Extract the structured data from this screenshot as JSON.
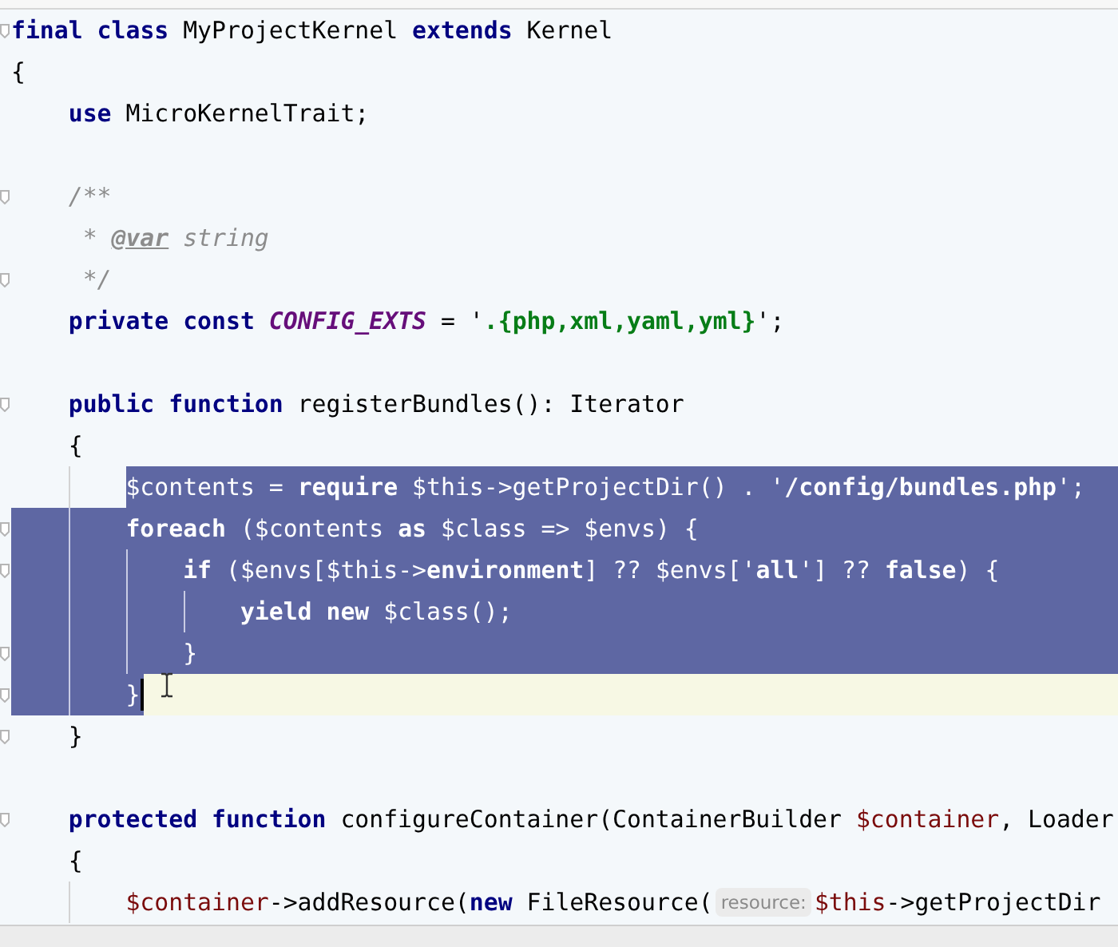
{
  "editor": {
    "lines": [
      {
        "fold": true,
        "selected": false,
        "current": false,
        "caret": false,
        "tokens": [
          {
            "kind": "keyword",
            "text": "final"
          },
          {
            "kind": "keyword",
            "text": " class"
          },
          {
            "kind": "plain",
            "text": " MyProjectKernel "
          },
          {
            "kind": "keyword",
            "text": "extends"
          },
          {
            "kind": "plain",
            "text": " Kernel"
          }
        ]
      },
      {
        "fold": false,
        "selected": false,
        "current": false,
        "caret": false,
        "tokens": [
          {
            "kind": "plain",
            "text": "{"
          }
        ]
      },
      {
        "fold": false,
        "selected": false,
        "current": false,
        "caret": false,
        "tokens": [
          {
            "kind": "keyword",
            "text": "    use"
          },
          {
            "kind": "plain",
            "text": " MicroKernelTrait;"
          }
        ]
      },
      {
        "fold": false,
        "selected": false,
        "current": false,
        "caret": false
      },
      {
        "fold": true,
        "selected": false,
        "current": false,
        "caret": false,
        "tokens": [
          {
            "kind": "comment",
            "text": "    /**"
          }
        ]
      },
      {
        "fold": false,
        "selected": false,
        "current": false,
        "caret": false,
        "tokens": [
          {
            "kind": "comment",
            "text": "     * "
          },
          {
            "kind": "doc_tag",
            "text": "@var"
          },
          {
            "kind": "comment",
            "text": " string"
          }
        ]
      },
      {
        "fold": true,
        "selected": false,
        "current": false,
        "caret": false,
        "tokens": [
          {
            "kind": "comment",
            "text": "     */"
          }
        ]
      },
      {
        "fold": false,
        "selected": false,
        "current": false,
        "caret": false,
        "tokens": [
          {
            "kind": "keyword",
            "text": "    private"
          },
          {
            "kind": "keyword",
            "text": " const"
          },
          {
            "kind": "constant",
            "text": " CONFIG_EXTS"
          },
          {
            "kind": "plain",
            "text": " = '"
          },
          {
            "kind": "string",
            "text": ".{php,xml,yaml,yml}"
          },
          {
            "kind": "plain",
            "text": "';"
          }
        ]
      },
      {
        "fold": false,
        "selected": false,
        "current": false,
        "caret": false
      },
      {
        "fold": true,
        "selected": false,
        "current": false,
        "caret": false,
        "tokens": [
          {
            "kind": "keyword",
            "text": "    public"
          },
          {
            "kind": "keyword",
            "text": " function"
          },
          {
            "kind": "plain",
            "text": " registerBundles(): Iterator"
          }
        ]
      },
      {
        "fold": false,
        "selected": false,
        "current": false,
        "caret": false,
        "tokens": [
          {
            "kind": "plain",
            "text": "    {"
          }
        ]
      },
      {
        "fold": false,
        "selected": true,
        "current": false,
        "caret": false,
        "tokens": [
          {
            "kind": "variable",
            "text": "        $contents"
          },
          {
            "kind": "plain",
            "text": " = "
          },
          {
            "kind": "keyword",
            "text": "require"
          },
          {
            "kind": "variable",
            "text": " $this"
          },
          {
            "kind": "plain",
            "text": "->getProjectDir() . '"
          },
          {
            "kind": "string",
            "text": "/config/bundles.php"
          },
          {
            "kind": "plain",
            "text": "';"
          }
        ]
      },
      {
        "fold": true,
        "selected": true,
        "current": false,
        "caret": false,
        "tokens": [
          {
            "kind": "keyword",
            "text": "        foreach"
          },
          {
            "kind": "plain",
            "text": " ("
          },
          {
            "kind": "variable",
            "text": "$contents"
          },
          {
            "kind": "keyword",
            "text": " as"
          },
          {
            "kind": "variable",
            "text": " $class"
          },
          {
            "kind": "plain",
            "text": " => "
          },
          {
            "kind": "variable",
            "text": "$envs"
          },
          {
            "kind": "plain",
            "text": ") {"
          }
        ]
      },
      {
        "fold": true,
        "selected": true,
        "current": false,
        "caret": false,
        "tokens": [
          {
            "kind": "keyword",
            "text": "            if"
          },
          {
            "kind": "plain",
            "text": " ("
          },
          {
            "kind": "variable",
            "text": "$envs"
          },
          {
            "kind": "plain",
            "text": "["
          },
          {
            "kind": "variable",
            "text": "$this"
          },
          {
            "kind": "plain",
            "text": "->"
          },
          {
            "kind": "field",
            "text": "environment"
          },
          {
            "kind": "plain",
            "text": "] ?? "
          },
          {
            "kind": "variable",
            "text": "$envs"
          },
          {
            "kind": "plain",
            "text": "['"
          },
          {
            "kind": "string",
            "text": "all"
          },
          {
            "kind": "plain",
            "text": "'] ?? "
          },
          {
            "kind": "keyword",
            "text": "false"
          },
          {
            "kind": "plain",
            "text": ") {"
          }
        ]
      },
      {
        "fold": false,
        "selected": true,
        "current": false,
        "caret": false,
        "tokens": [
          {
            "kind": "keyword",
            "text": "                yield"
          },
          {
            "kind": "keyword",
            "text": " new"
          },
          {
            "kind": "variable",
            "text": " $class"
          },
          {
            "kind": "plain",
            "text": "();"
          }
        ]
      },
      {
        "fold": true,
        "selected": true,
        "current": false,
        "caret": false,
        "tokens": [
          {
            "kind": "plain",
            "text": "            }"
          }
        ]
      },
      {
        "fold": true,
        "selected": true,
        "current": true,
        "caret": true,
        "tokens": [
          {
            "kind": "plain",
            "text": "        }"
          }
        ]
      },
      {
        "fold": true,
        "selected": false,
        "current": false,
        "caret": false,
        "tokens": [
          {
            "kind": "plain",
            "text": "    }"
          }
        ]
      },
      {
        "fold": false,
        "selected": false,
        "current": false,
        "caret": false
      },
      {
        "fold": true,
        "selected": false,
        "current": false,
        "caret": false,
        "tokens": [
          {
            "kind": "keyword",
            "text": "    protected"
          },
          {
            "kind": "keyword",
            "text": " function"
          },
          {
            "kind": "plain",
            "text": " configureContainer(ContainerBuilder "
          },
          {
            "kind": "variable",
            "text": "$container"
          },
          {
            "kind": "plain",
            "text": ", Loader"
          }
        ]
      },
      {
        "fold": false,
        "selected": false,
        "current": false,
        "caret": false,
        "tokens": [
          {
            "kind": "plain",
            "text": "    {"
          }
        ]
      },
      {
        "fold": false,
        "selected": false,
        "current": false,
        "caret": false,
        "tokens": [
          {
            "kind": "variable",
            "text": "        $container"
          },
          {
            "kind": "plain",
            "text": "->addResource("
          },
          {
            "kind": "keyword",
            "text": "new"
          },
          {
            "kind": "plain",
            "text": " FileResource("
          },
          {
            "kind": "hint",
            "text": "resource:"
          },
          {
            "kind": "variable",
            "text": "$this"
          },
          {
            "kind": "plain",
            "text": "->getProjectDir"
          }
        ]
      }
    ]
  }
}
